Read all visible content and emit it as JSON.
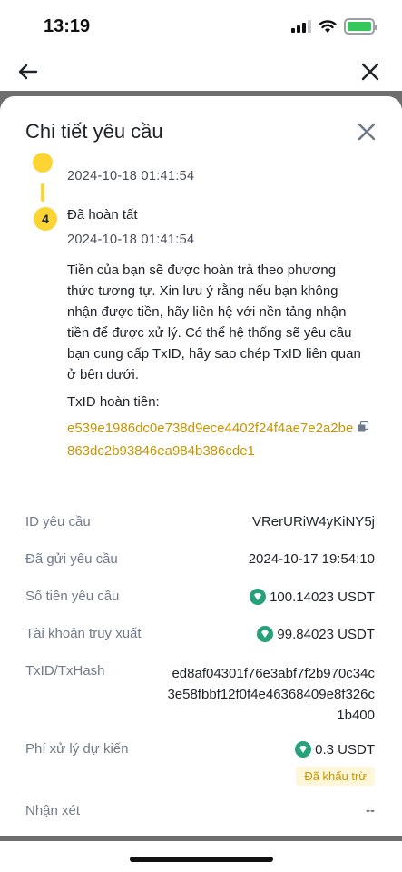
{
  "status_bar": {
    "time": "13:19"
  },
  "sheet": {
    "title": "Chi tiết yêu cầu",
    "timeline": {
      "prev_timestamp": "2024-10-18 01:41:54",
      "step_number": "4",
      "step_title": "Đã hoàn tất",
      "step_timestamp": "2024-10-18 01:41:54",
      "description": "Tiền của bạn sẽ được hoàn trả theo phương thức tương tự. Xin lưu ý rằng nếu bạn không nhận được tiền, hãy liên hệ với nền tảng nhận tiền để được xử lý. Có thể hệ thống sẽ yêu cầu bạn cung cấp TxID, hãy sao chép TxID liên quan ở bên dưới.",
      "refund_txid_label": "TxID hoàn tiền:",
      "refund_txid": "e539e1986dc0e738d9ece4402f24f4ae7e2a2be863dc2b93846ea984b386cde1"
    },
    "details": {
      "request_id": {
        "label": "ID yêu cầu",
        "value": "VRerURiW4yKiNY5j"
      },
      "sent_request": {
        "label": "Đã gửi yêu cầu",
        "value": "2024-10-17 19:54:10"
      },
      "requested_amount": {
        "label": "Số tiền yêu cầu",
        "value": "100.14023 USDT"
      },
      "retrieval_account": {
        "label": "Tài khoản truy xuất",
        "value": "99.84023 USDT"
      },
      "txid_hash": {
        "label": "TxID/TxHash",
        "value": "ed8af04301f76e3abf7f2b970c34c3e58fbbf12f0f4e46368409e8f326c1b400"
      },
      "processing_fee": {
        "label": "Phí xử lý dự kiến",
        "value": "0.3 USDT",
        "badge": "Đã khấu trừ"
      },
      "remark": {
        "label": "Nhận xét",
        "value": "--"
      }
    }
  },
  "colors": {
    "accent": "#fcd535",
    "link": "#c99400",
    "usdt": "#26a17b",
    "muted": "#707a8a"
  },
  "icons": [
    "back-arrow-icon",
    "close-icon",
    "copy-icon",
    "usdt-icon",
    "signal-icon",
    "wifi-icon",
    "battery-icon"
  ]
}
